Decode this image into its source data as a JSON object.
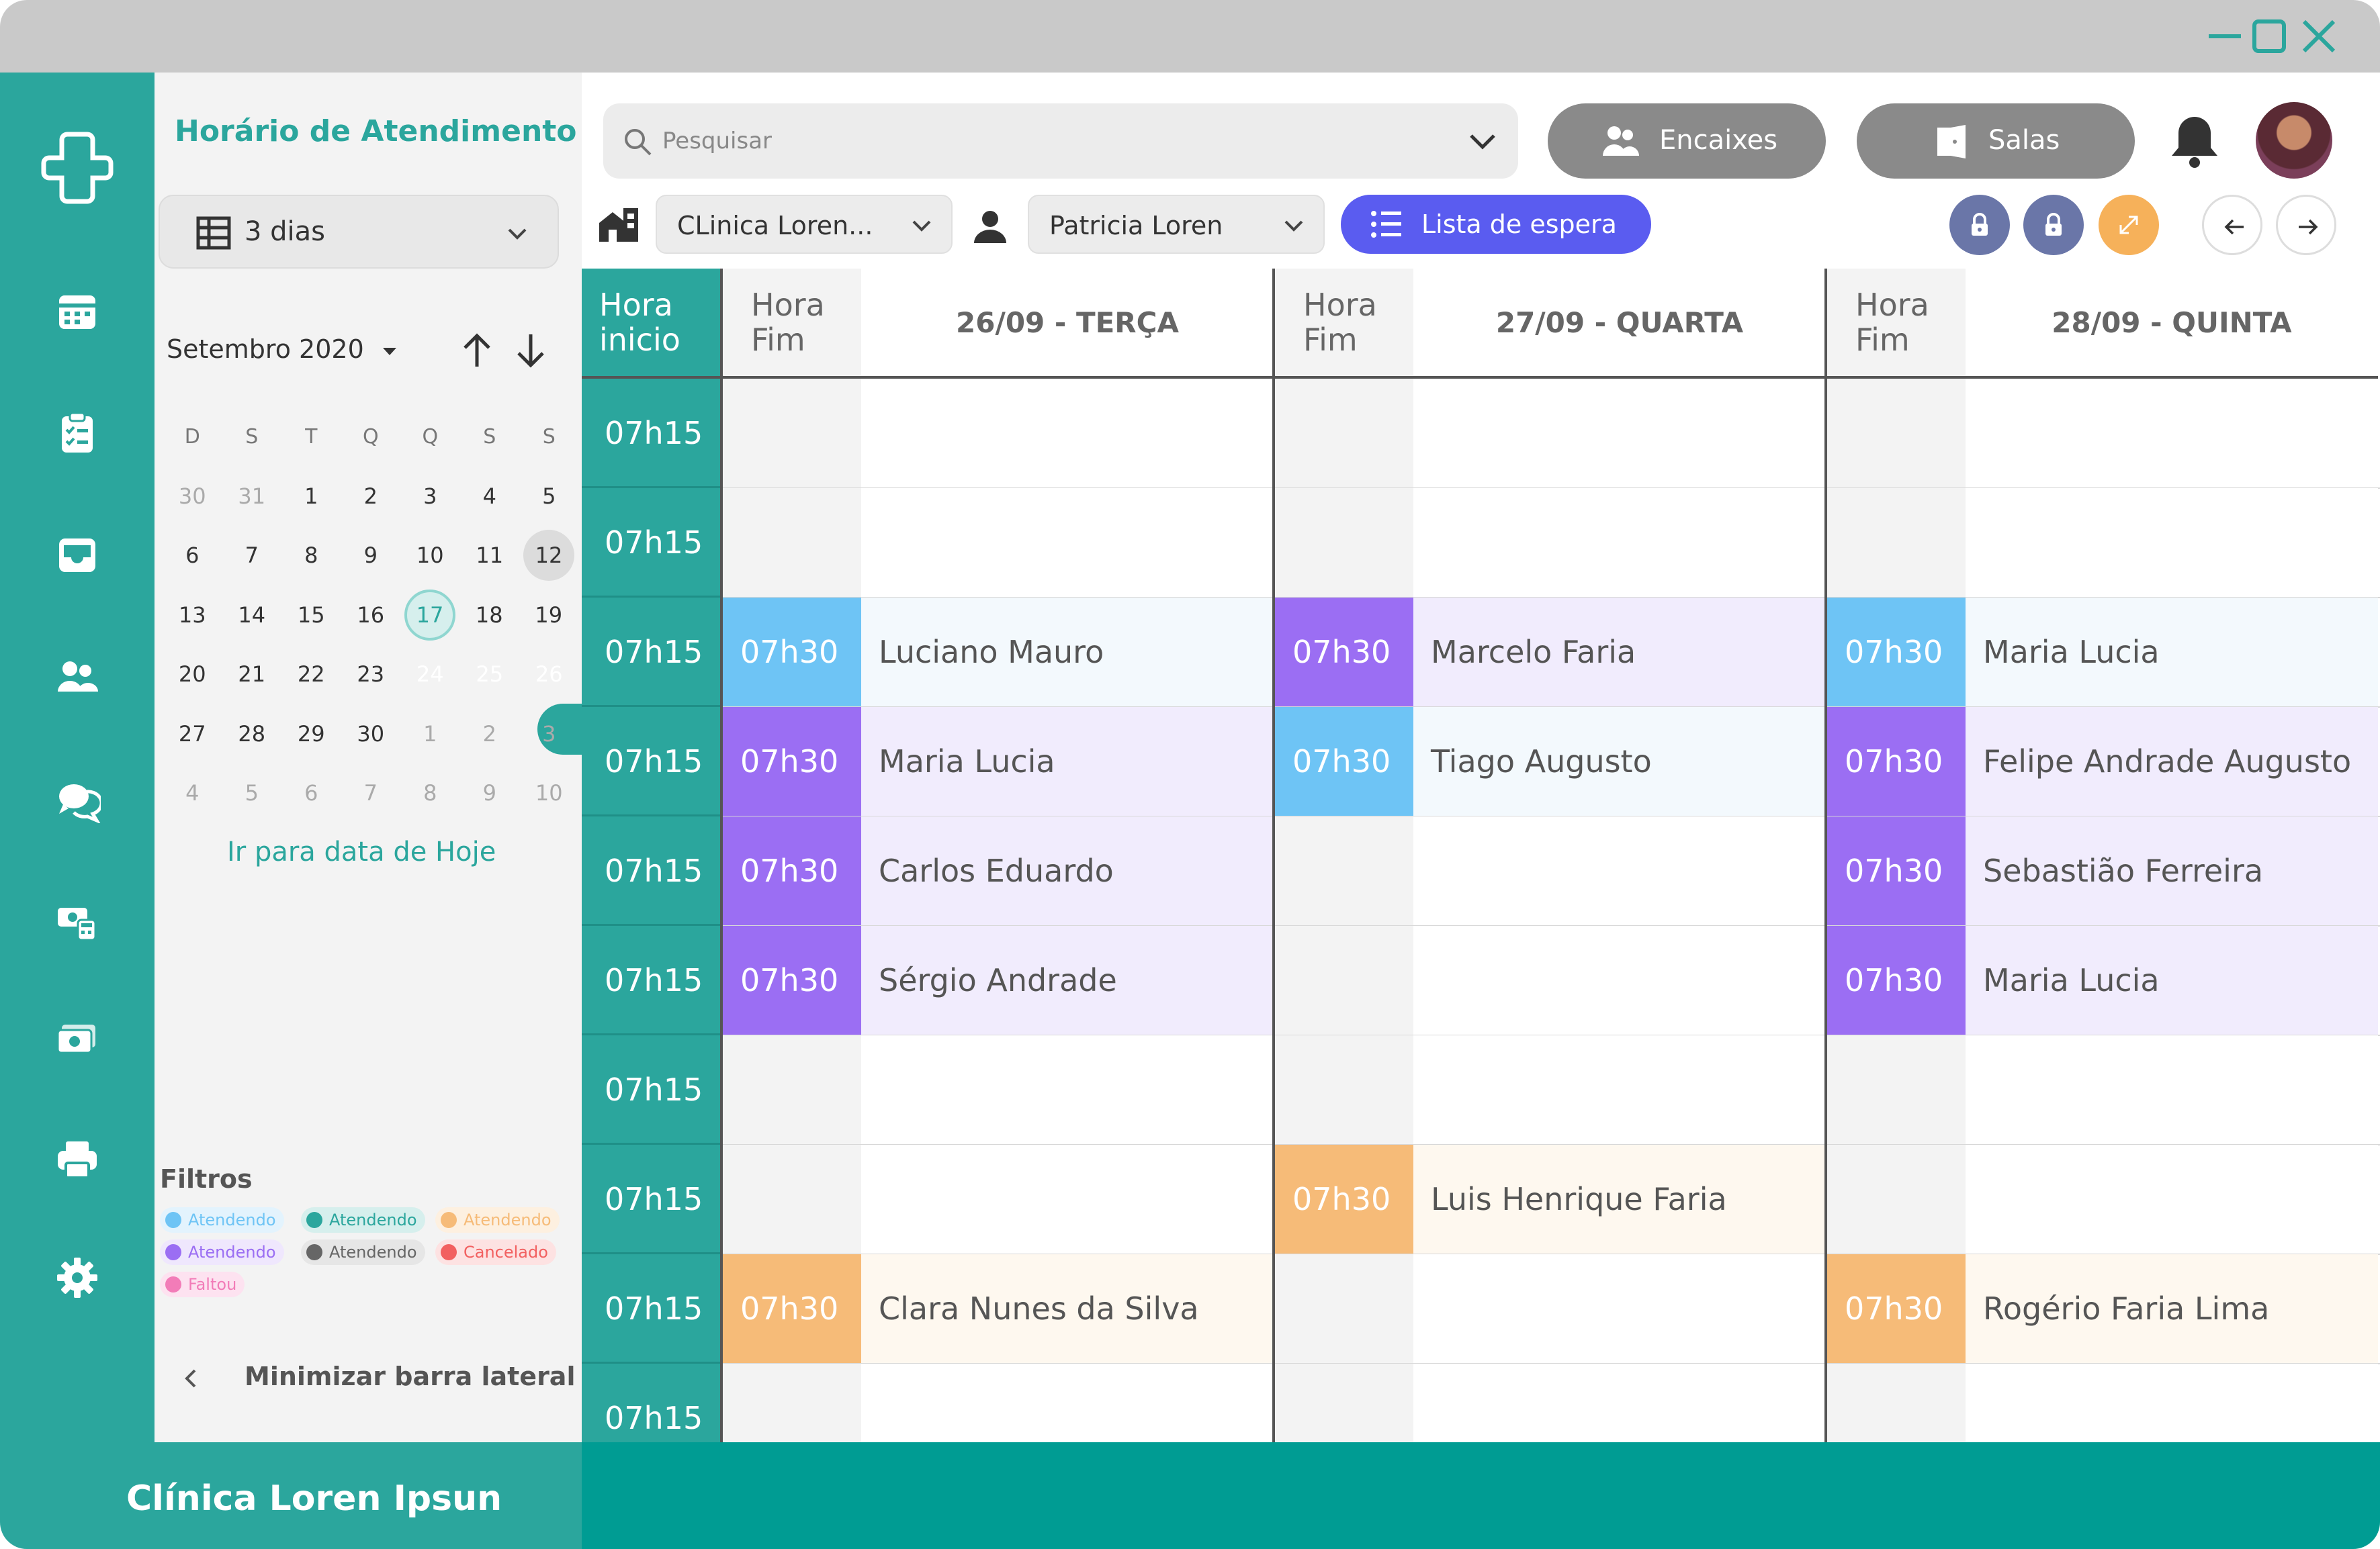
{
  "colors": {
    "teal": "#2ba69d",
    "teal_dark": "#009c93",
    "blue": "#6ec4f5",
    "purple": "#9b6ef3",
    "orange": "#f6bb78",
    "indigo": "#5a5cf0",
    "gray_button": "#8a8a8a",
    "lock_button": "#6a76a8",
    "expand_button": "#f6b15a"
  },
  "sidebar": {
    "title": "Horário de Atendimento",
    "days_select": "3 dias",
    "month_label": "Setembro 2020",
    "weekdays": [
      "D",
      "S",
      "T",
      "Q",
      "Q",
      "S",
      "S"
    ],
    "weeks": [
      [
        {
          "d": "30",
          "m": 1
        },
        {
          "d": "31",
          "m": 1
        },
        {
          "d": "1"
        },
        {
          "d": "2"
        },
        {
          "d": "3"
        },
        {
          "d": "4"
        },
        {
          "d": "5"
        }
      ],
      [
        {
          "d": "6"
        },
        {
          "d": "7"
        },
        {
          "d": "8"
        },
        {
          "d": "9"
        },
        {
          "d": "10"
        },
        {
          "d": "11"
        },
        {
          "d": "12",
          "today": 1
        }
      ],
      [
        {
          "d": "13"
        },
        {
          "d": "14"
        },
        {
          "d": "15"
        },
        {
          "d": "16"
        },
        {
          "d": "17",
          "sel": 1
        },
        {
          "d": "18"
        },
        {
          "d": "19"
        }
      ],
      [
        {
          "d": "20"
        },
        {
          "d": "21"
        },
        {
          "d": "22"
        },
        {
          "d": "23"
        },
        {
          "d": "24",
          "range": 1
        },
        {
          "d": "25",
          "range": 1
        },
        {
          "d": "26",
          "range": 1
        }
      ],
      [
        {
          "d": "27"
        },
        {
          "d": "28"
        },
        {
          "d": "29"
        },
        {
          "d": "30"
        },
        {
          "d": "1",
          "m": 1
        },
        {
          "d": "2",
          "m": 1
        },
        {
          "d": "3",
          "m": 1
        }
      ],
      [
        {
          "d": "4",
          "m": 1
        },
        {
          "d": "5",
          "m": 1
        },
        {
          "d": "6",
          "m": 1
        },
        {
          "d": "7",
          "m": 1
        },
        {
          "d": "8",
          "m": 1
        },
        {
          "d": "9",
          "m": 1
        },
        {
          "d": "10",
          "m": 1
        }
      ]
    ],
    "goto_today": "Ir para data de Hoje",
    "filters_title": "Filtros",
    "filters": [
      {
        "label": "Atendendo",
        "color": "#6ec4f5",
        "bg": "#e3f3fd",
        "text": "#6ec4f5"
      },
      {
        "label": "Atendendo",
        "color": "#2ba69d",
        "bg": "#d6efed",
        "text": "#2ba69d"
      },
      {
        "label": "Atendendo",
        "color": "#f6bb78",
        "bg": "#fdf0e0",
        "text": "#f6bb78"
      },
      {
        "label": "Atendendo",
        "color": "#9b6ef3",
        "bg": "#efe7fd",
        "text": "#9b6ef3"
      },
      {
        "label": "Atendendo",
        "color": "#666666",
        "bg": "#e6e6e6",
        "text": "#666666"
      },
      {
        "label": "Cancelado",
        "color": "#f26060",
        "bg": "#fde2e2",
        "text": "#f26060"
      },
      {
        "label": "Faltou",
        "color": "#f27cb8",
        "bg": "#fde2f0",
        "text": "#f27cb8"
      }
    ],
    "minimize": "Minimizar barra lateral"
  },
  "footer": {
    "clinic": "Clínica Loren Ipsun"
  },
  "toolbar": {
    "search_placeholder": "Pesquisar",
    "encaixes": "Encaixes",
    "salas": "Salas",
    "clinic_select": "CLinica Loren...",
    "professional_select": "Patricia Loren",
    "waitlist": "Lista de espera"
  },
  "schedule": {
    "start_header": "Hora\ninicio",
    "end_header": "Hora\nFim",
    "days": [
      "26/09 - TERÇA",
      "27/09 - QUARTA",
      "28/09 - QUINTA"
    ],
    "row_times": [
      "07h15",
      "07h15",
      "07h15",
      "07h15",
      "07h15",
      "07h15",
      "07h15",
      "07h15",
      "07h15",
      "07h15"
    ],
    "appointments": [
      [
        null,
        null,
        null
      ],
      [
        null,
        null,
        null
      ],
      [
        {
          "end": "07h30",
          "name": "Luciano Mauro",
          "color": "blue"
        },
        {
          "end": "07h30",
          "name": "Marcelo Faria",
          "color": "purple"
        },
        {
          "end": "07h30",
          "name": "Maria Lucia",
          "color": "blue"
        }
      ],
      [
        {
          "end": "07h30",
          "name": "Maria Lucia",
          "color": "purple"
        },
        {
          "end": "07h30",
          "name": "Tiago Augusto",
          "color": "blue"
        },
        {
          "end": "07h30",
          "name": "Felipe Andrade Augusto",
          "color": "purple"
        }
      ],
      [
        {
          "end": "07h30",
          "name": "Carlos Eduardo",
          "color": "purple"
        },
        null,
        {
          "end": "07h30",
          "name": "Sebastião Ferreira",
          "color": "purple"
        }
      ],
      [
        {
          "end": "07h30",
          "name": "Sérgio Andrade",
          "color": "purple"
        },
        null,
        {
          "end": "07h30",
          "name": "Maria Lucia",
          "color": "purple"
        }
      ],
      [
        null,
        null,
        null
      ],
      [
        null,
        {
          "end": "07h30",
          "name": "Luis Henrique Faria",
          "color": "orange"
        },
        null
      ],
      [
        {
          "end": "07h30",
          "name": "Clara Nunes da Silva",
          "color": "orange"
        },
        null,
        {
          "end": "07h30",
          "name": "Rogério Faria Lima",
          "color": "orange"
        }
      ],
      [
        null,
        null,
        null
      ]
    ]
  }
}
